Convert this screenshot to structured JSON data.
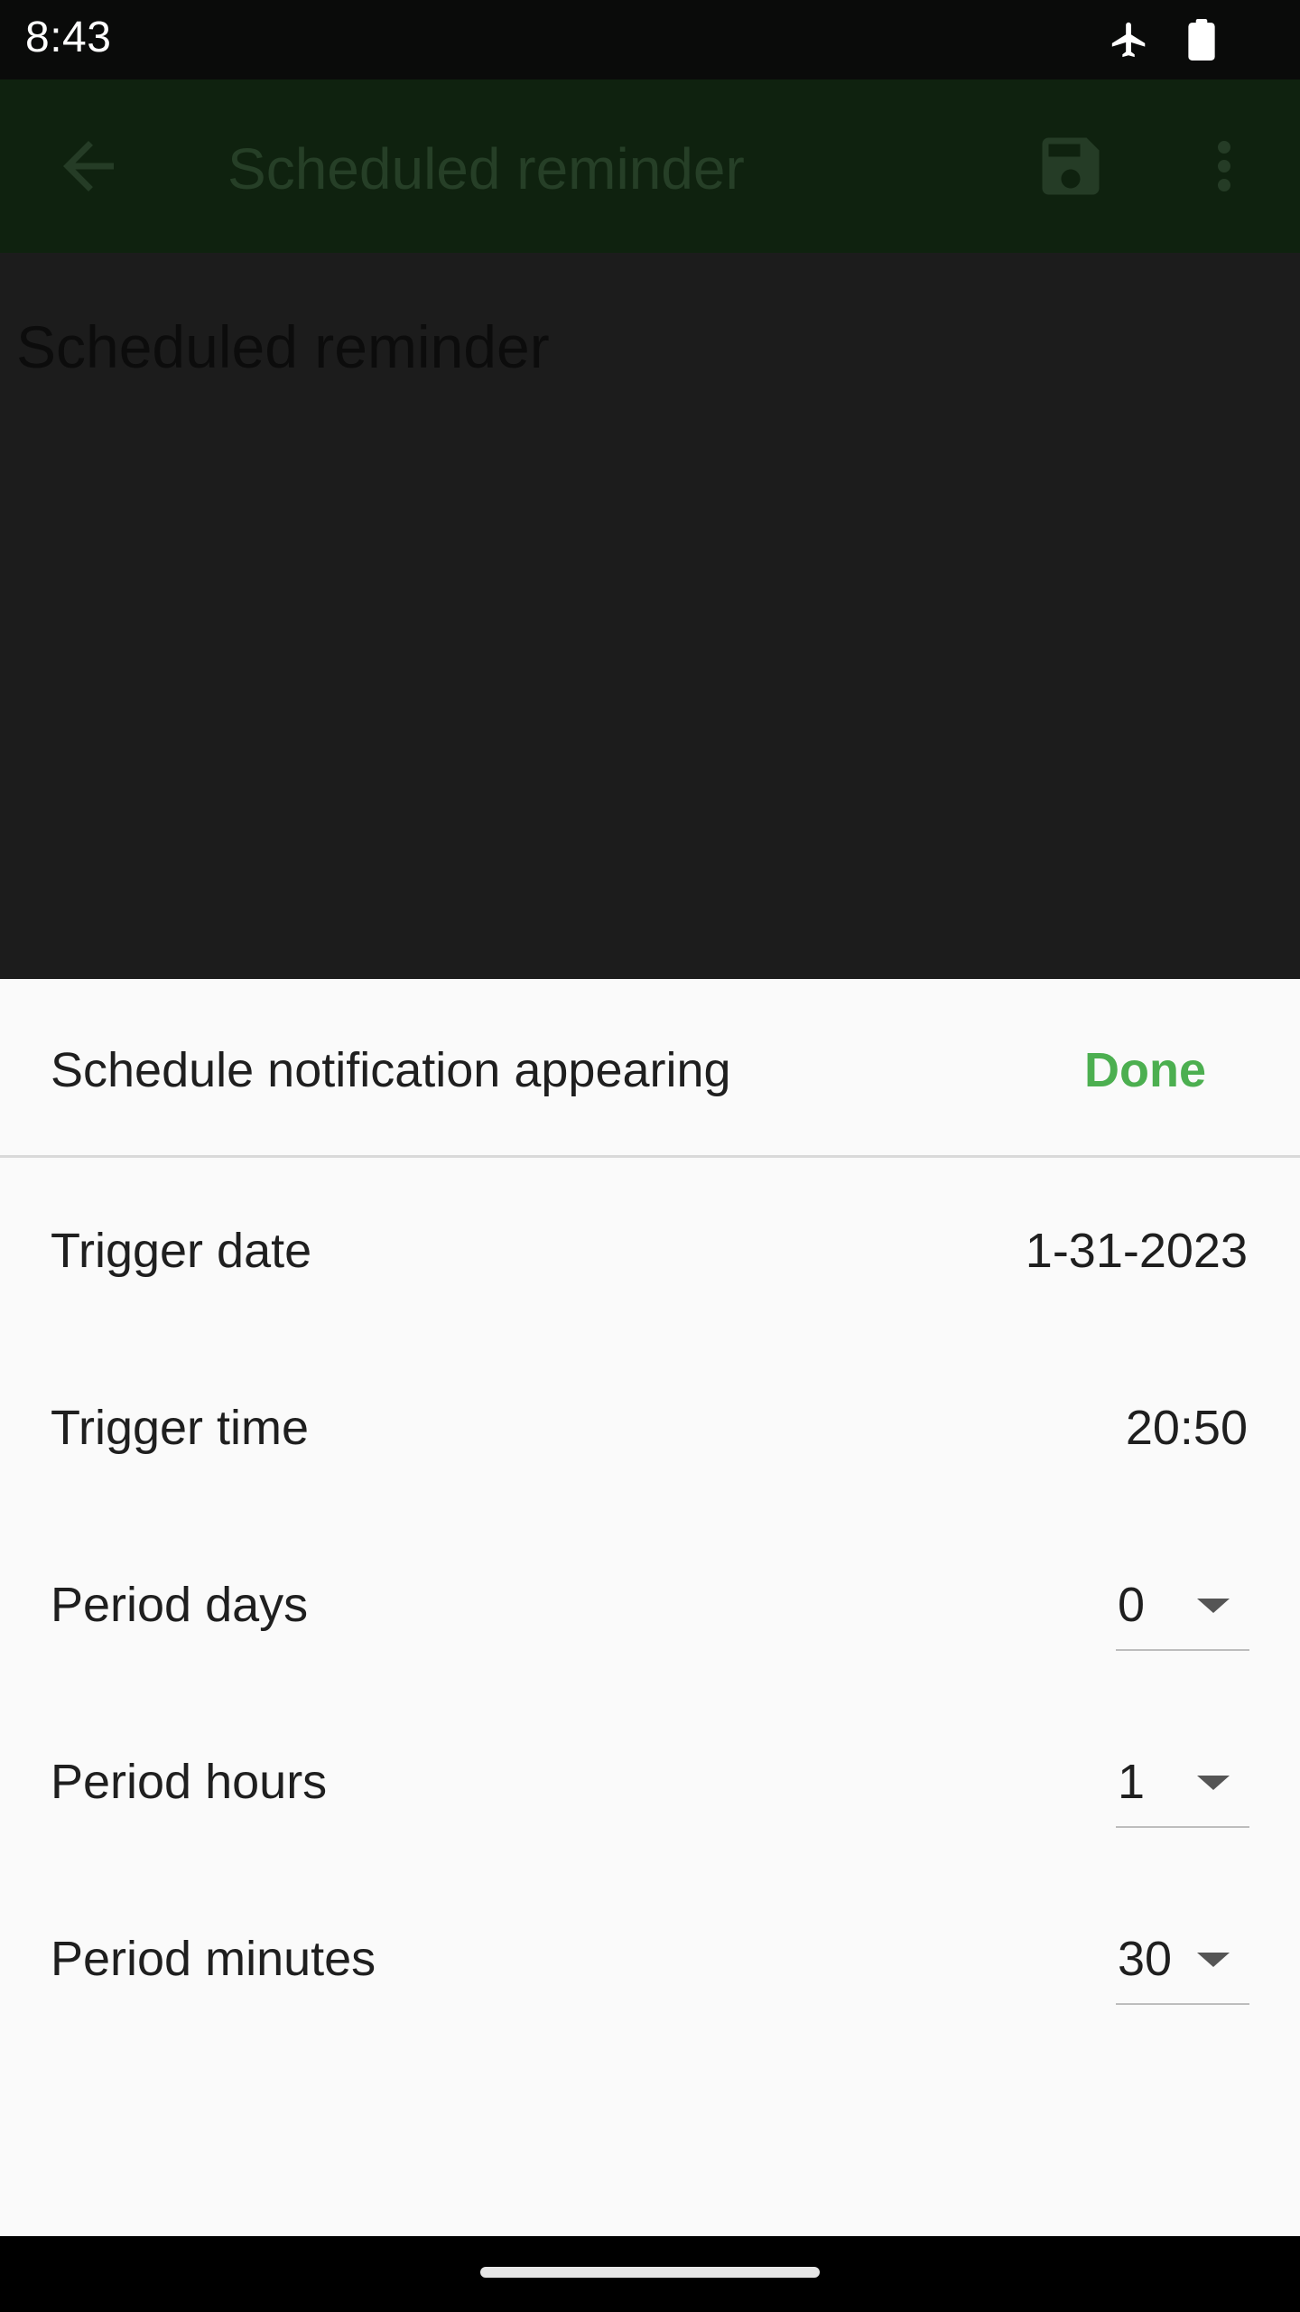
{
  "status_bar": {
    "time": "8:43",
    "icons": [
      "airplane-icon",
      "battery-icon"
    ]
  },
  "app_bar": {
    "title": "Scheduled reminder",
    "icons": [
      "back-arrow-icon",
      "save-icon",
      "more-vert-icon"
    ]
  },
  "content": {
    "heading": "Scheduled reminder"
  },
  "sheet": {
    "title": "Schedule notification appearing",
    "done_label": "Done",
    "rows": [
      {
        "label": "Trigger date",
        "value": "1-31-2023",
        "kind": "text"
      },
      {
        "label": "Trigger time",
        "value": "20:50",
        "kind": "text"
      },
      {
        "label": "Period days",
        "value": "0",
        "kind": "dropdown"
      },
      {
        "label": "Period hours",
        "value": "1",
        "kind": "dropdown"
      },
      {
        "label": "Period minutes",
        "value": "30",
        "kind": "dropdown"
      }
    ]
  },
  "colors": {
    "accent": "#4caf50",
    "app_bar_dimmed": "#0f220f",
    "scrim_background": "#1c1c1c",
    "sheet_background": "#fafafa"
  }
}
